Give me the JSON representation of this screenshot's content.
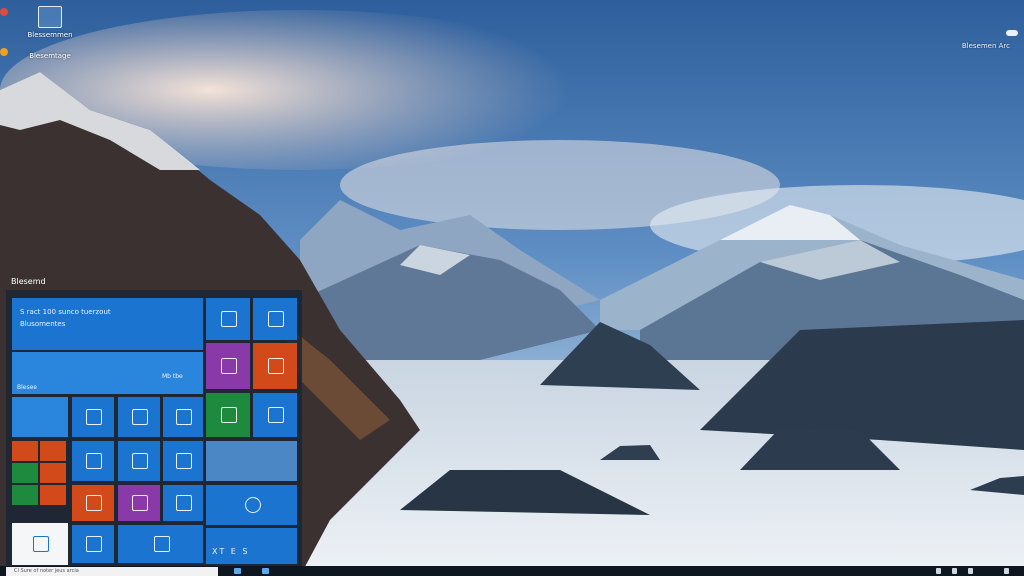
{
  "desktop": {
    "icons": [
      {
        "name": "recycle-bin",
        "label": "Blessemmen"
      },
      {
        "name": "shortcut",
        "label": "Blesemtage"
      }
    ],
    "top_right_text": "Blesemen Arc"
  },
  "start_menu": {
    "header": "Blesemd",
    "big_tile": {
      "line1": "S  ract 100 sunco tuerzout",
      "line2": "Blusomentes",
      "footer": "Blesee"
    },
    "wide_tile_small_text": "Mb tbe",
    "bottom_tile_text": "XT E  S",
    "colors": {
      "accent": "#1b74d0",
      "red": "#d24a1a",
      "green": "#1d8a3d",
      "purple": "#8a3aa8"
    }
  },
  "taskbar": {
    "search_placeholder": "Cl Sure of noter jeus arcia"
  }
}
